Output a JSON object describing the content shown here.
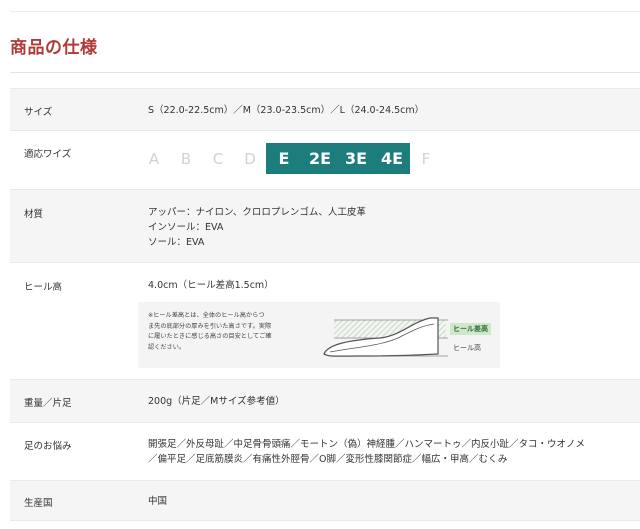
{
  "section": {
    "title": "商品の仕様"
  },
  "specs": {
    "size": {
      "label": "サイズ",
      "value": "S（22.0-22.5cm）／M（23.0-23.5cm）／L（24.0-24.5cm）"
    },
    "wise": {
      "label": "適応ワイズ",
      "options": [
        "A",
        "B",
        "C",
        "D",
        "E",
        "2E",
        "3E",
        "4E",
        "F"
      ],
      "active": [
        "E",
        "2E",
        "3E",
        "4E"
      ],
      "active_color": "#1d7d7d"
    },
    "material": {
      "label": "材質",
      "lines": [
        "アッパー：ナイロン、クロロプレンゴム、人工皮革",
        "インソール：EVA",
        "ソール：EVA"
      ]
    },
    "heel": {
      "label": "ヒール高",
      "value": "4.0cm（ヒール差高1.5cm）",
      "note": [
        "※ヒール差高とは、全体のヒール高からつ",
        "ま先の底部分の厚みを引いた高さです。実際",
        "に履いたときに感じる高さの目安としてご確",
        "認ください。"
      ],
      "legend_diff": "ヒール差高",
      "legend_heel": "ヒール高"
    },
    "weight": {
      "label": "重量／片足",
      "value": "200g（片足／Mサイズ参考値）"
    },
    "concerns": {
      "label": "足のお悩み",
      "lines": [
        "開張足／外反母趾／中足骨骨頭痛／モートン（偽）神経腫／ハンマートゥ／内反小趾／タコ・ウオノメ",
        "／偏平足／足底筋膜炎／有痛性外脛骨／O脚／変形性膝関節症／幅広・甲高／むくみ"
      ]
    },
    "origin": {
      "label": "生産国",
      "value": "中国"
    }
  },
  "colors": {
    "title": "#b13a36",
    "row_shade": "#f5f5f5",
    "accent": "#1d7d7d"
  }
}
